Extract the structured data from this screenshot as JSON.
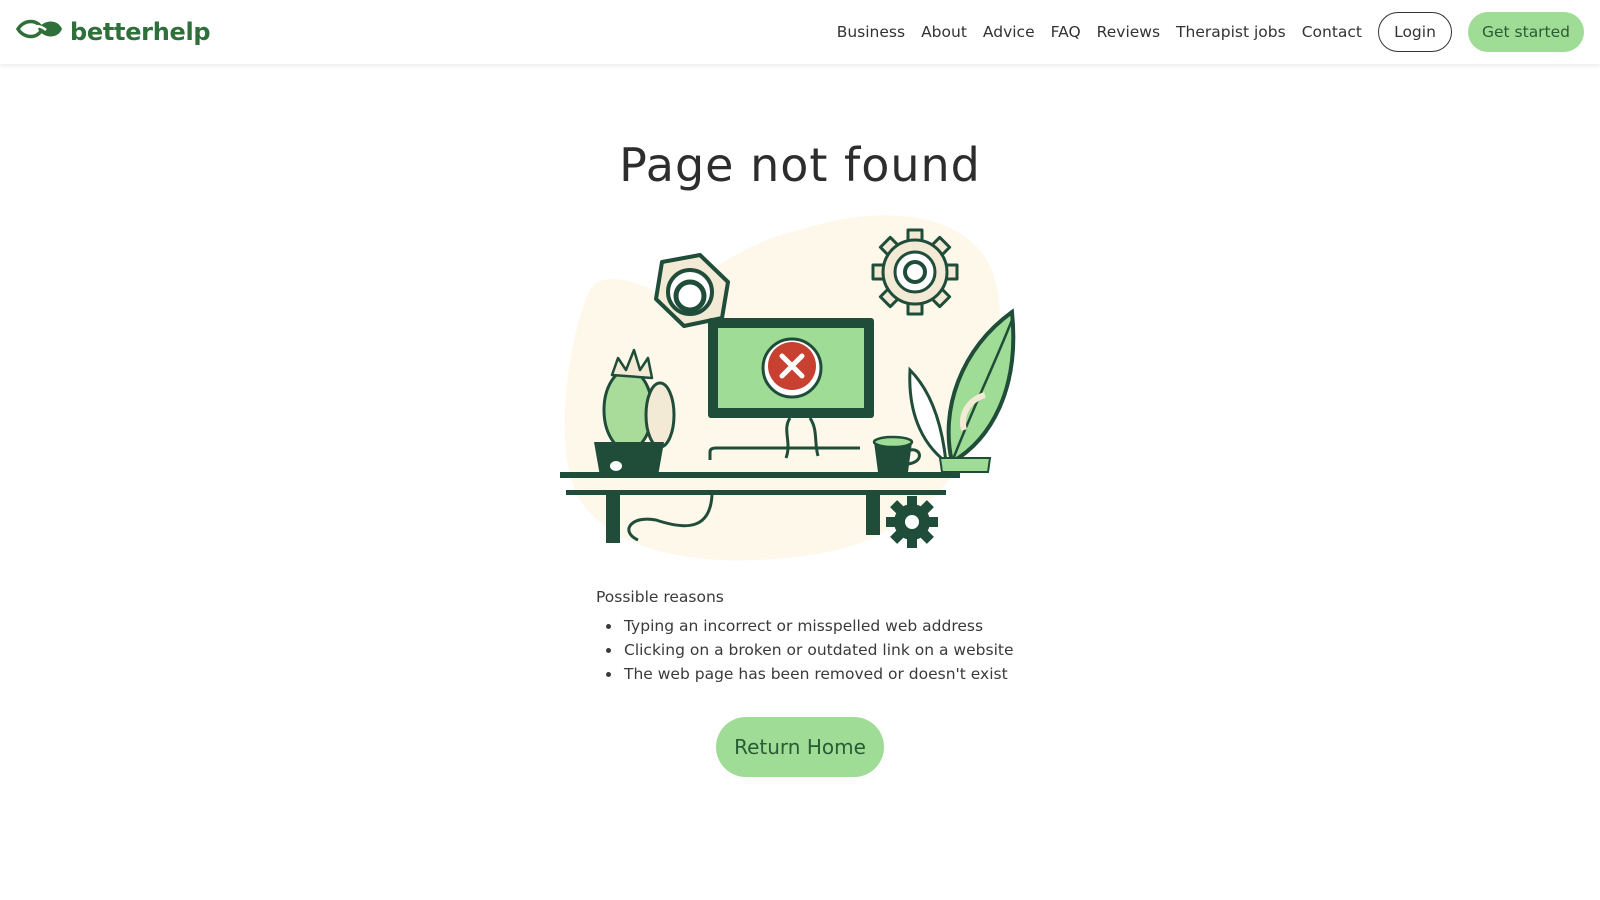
{
  "header": {
    "logo_text": "betterhelp",
    "nav": [
      "Business",
      "About",
      "Advice",
      "FAQ",
      "Reviews",
      "Therapist jobs",
      "Contact"
    ],
    "login_label": "Login",
    "get_started_label": "Get started"
  },
  "main": {
    "title": "Page not found",
    "reasons_title": "Possible reasons",
    "reasons": [
      "Typing an incorrect or misspelled web address",
      "Clicking on a broken or outdated link on a website",
      "The web page has been removed or doesn't exist"
    ],
    "return_home_label": "Return Home"
  },
  "colors": {
    "brand_green": "#2e6f3a",
    "button_green": "#9fdc95",
    "dark_green": "#1f4d3a",
    "error_red": "#c8402f",
    "blob_cream": "#fdf8ea"
  },
  "icons": [
    "logo-leaf-icon",
    "error-x-icon",
    "gear-icon",
    "hex-nut-icon",
    "cactus-icon",
    "plant-icon",
    "coffee-cup-icon",
    "monitor-icon"
  ]
}
